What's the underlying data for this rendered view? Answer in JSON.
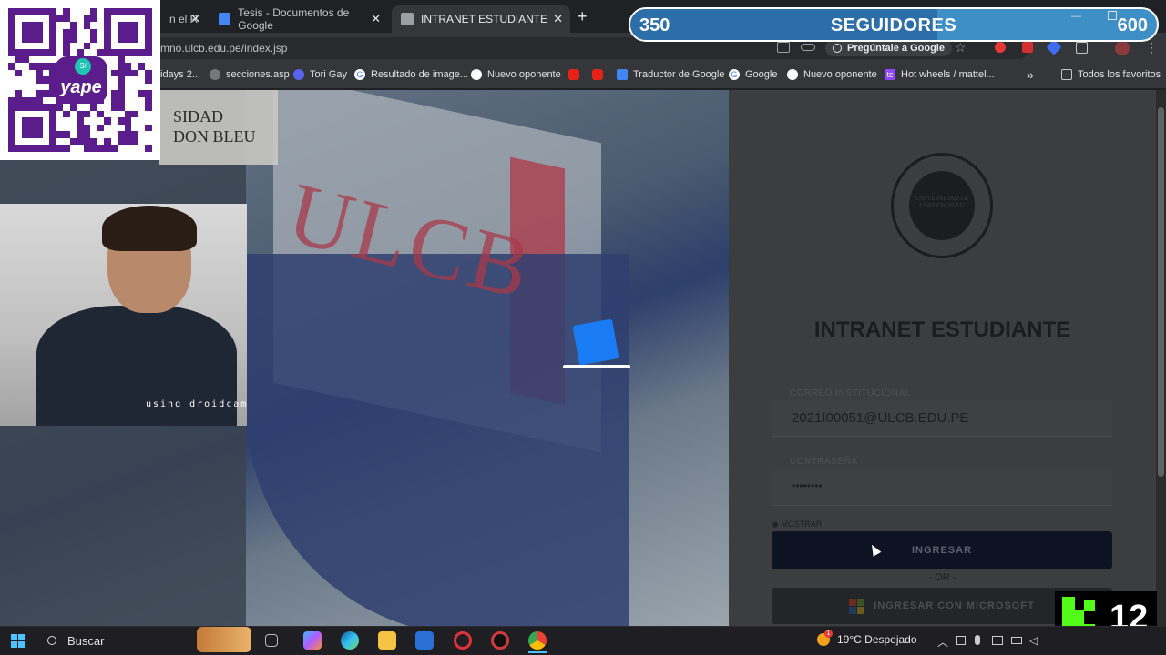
{
  "browser": {
    "tabs": [
      {
        "label": "n el R",
        "active": false
      },
      {
        "label": "Tesis - Documentos de Google",
        "active": false
      },
      {
        "label": "INTRANET ESTUDIANTE",
        "active": true
      }
    ],
    "close_glyph": "✕",
    "new_tab_glyph": "+",
    "url": "mno.ulcb.edu.pe/index.jsp",
    "ask_google": "Pregúntale a Google",
    "bookmarks": [
      "idays 2...",
      "secciones.asp",
      "Tori Gay",
      "Resultado de image...",
      "Nuevo oponente",
      "Traductor de Google",
      "Google",
      "Nuevo oponente",
      "Hot wheels / mattel..."
    ],
    "bookmarks_overflow": "»",
    "all_favorites": "Todos los favoritos"
  },
  "page": {
    "logo_line1": "SIDAD",
    "logo_line2": "DON BLEU",
    "wall_letters": "ULCB",
    "heading": "INTRANET ESTUDIANTE",
    "email_label": "CORREO INSTITUCIONAL",
    "email_value": "2021I00051@ULCB.EDU.PE",
    "password_label": "CONTRASEÑA",
    "password_value": "••••••••",
    "show_label": "MOSTRAR",
    "login_button": "INGRESAR",
    "or_text": "- OR -",
    "microsoft_button": "INGRESAR CON MICROSOFT",
    "crest_text": "UNIVERSIDAD LE CORDON BLEU"
  },
  "overlays": {
    "qr_brand": "yape",
    "qr_coin": "S/",
    "cam_label": "using droidcam",
    "followers_current": "350",
    "followers_label": "SEGUIDORES",
    "followers_goal": "600",
    "followers_progress": 0.583,
    "kick_count": "12"
  },
  "taskbar": {
    "search_placeholder": "Buscar",
    "weather": "19°C  Despejado",
    "weather_alert": "1"
  },
  "colors": {
    "accent_blue": "#1a7cf5",
    "kick_green": "#53fc18",
    "yape_purple": "#5b1c8c",
    "followers_bar": "#3f8fc7"
  }
}
